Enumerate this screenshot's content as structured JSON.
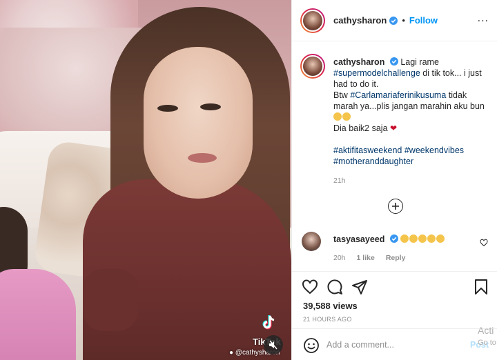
{
  "post": {
    "username": "cathysharon",
    "follow_label": "Follow",
    "dot": "•",
    "more_label": "...",
    "caption": {
      "username": "cathysharon",
      "text_1": "Lagi rame",
      "tag_supermodel": "#supermodelchallenge",
      "text_2": "di tik tok... i just had to do it.",
      "text_btw": "Btw",
      "tag_carla": "#Carlamariaferinikusuma",
      "text_3": "tidak marah ya...plis jangan marahin aku bun",
      "text_4": "Dia baik2 saja",
      "tag_aktifitas": "#aktifitasweekend",
      "tag_weekendvibes": "#weekendvibes",
      "tag_mother": "#motheranddaughter",
      "time": "21h"
    },
    "comment": {
      "username": "tasyasayeed",
      "likes": "1 like",
      "reply_label": "Reply",
      "time": "20h"
    },
    "views": "39,588 views",
    "posted": "21 HOURS AGO",
    "comment_input": {
      "placeholder": "Add a comment...",
      "post_label": "Post"
    }
  },
  "video": {
    "tiktok_label": "TikTok",
    "tiktok_handle": "@cathysharon"
  },
  "watermark": {
    "line1": "Acti",
    "line2": "Go to"
  },
  "colors": {
    "link": "#0095f6",
    "hashtag": "#00376b",
    "verified": "#3897f0",
    "heart": "#c8102e",
    "post_disabled": "#b2dffc"
  },
  "icons": [
    "verified-icon",
    "more-icon",
    "add-icon",
    "heart-icon",
    "comment-icon",
    "share-icon",
    "bookmark-icon",
    "smiley-icon",
    "mute-icon",
    "tiktok-icon"
  ]
}
